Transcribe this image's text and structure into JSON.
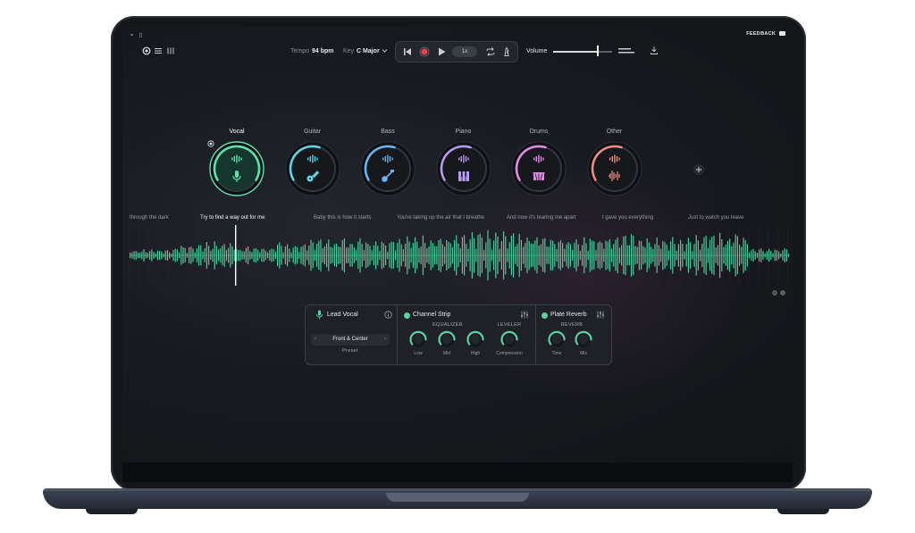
{
  "system": {
    "feedback_label": "FEEDBACK"
  },
  "toolbar": {
    "tempo_label": "Tempo",
    "tempo_value": "94 bpm",
    "key_label": "Key",
    "key_value": "C Major",
    "speed_label": "1x",
    "volume_label": "Volume",
    "volume_level": 0.75
  },
  "stems": [
    {
      "label": "Vocal",
      "color": "#5fe0b0",
      "icon": "microphone-icon",
      "selected": true
    },
    {
      "label": "Guitar",
      "color": "#5fd4e6",
      "icon": "guitar-icon",
      "selected": false
    },
    {
      "label": "Bass",
      "color": "#6ab4f2",
      "icon": "bass-guitar-icon",
      "selected": false
    },
    {
      "label": "Piano",
      "color": "#b69af0",
      "icon": "piano-icon",
      "selected": false
    },
    {
      "label": "Drums",
      "color": "#e18be6",
      "icon": "drum-icon",
      "selected": false
    },
    {
      "label": "Other",
      "color": "#ef8a80",
      "icon": "waveform-icon",
      "selected": false
    }
  ],
  "lyrics": [
    {
      "text": "through the dark",
      "active": false
    },
    {
      "text": "Try to find a way out for me",
      "active": true
    },
    {
      "text": "Baby this is how it starts",
      "active": false
    },
    {
      "text": "You're taking up the air that I breathe",
      "active": false
    },
    {
      "text": "And now it's tearing me apart",
      "active": false
    },
    {
      "text": "I gave you everything",
      "active": false
    },
    {
      "text": "Just to watch you leave",
      "active": false
    }
  ],
  "waveform_color": "#4fc99a",
  "effects": {
    "track_name": "Lead Vocal",
    "preset_value": "Front & Center",
    "preset_label": "Preset",
    "channel_strip_title": "Channel Strip",
    "equalizer_label": "EQUALIZER",
    "leveler_label": "LEVELER",
    "knobs_eq": [
      "Low",
      "Mid",
      "High"
    ],
    "knob_compression": "Compression",
    "plate_reverb_title": "Plate Reverb",
    "reverb_label": "REVERB",
    "knobs_reverb": [
      "Time",
      "Mix"
    ]
  }
}
